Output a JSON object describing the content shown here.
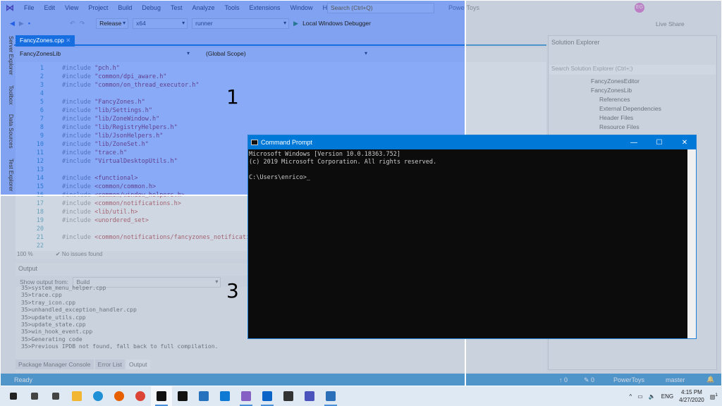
{
  "vs": {
    "menu": [
      "File",
      "Edit",
      "View",
      "Project",
      "Build",
      "Debug",
      "Test",
      "Analyze",
      "Tools",
      "Extensions",
      "Window",
      "Help"
    ],
    "search_placeholder": "Search (Ctrl+Q)",
    "solution_name": "PowerToys",
    "user_initials": "EG",
    "live_share": "Live Share",
    "config": "Release",
    "platform": "x64",
    "startup": "runner",
    "debugger": "Local Windows Debugger",
    "side_tools": [
      "Server Explorer",
      "Toolbox",
      "Data Sources",
      "Test Explorer"
    ],
    "tab": "FancyZones.cpp",
    "nav_project": "FancyZonesLib",
    "nav_scope": "(Global Scope)",
    "code": [
      [
        "1",
        "#include",
        "\"pch.h\""
      ],
      [
        "2",
        "#include",
        "\"common/dpi_aware.h\""
      ],
      [
        "3",
        "#include",
        "\"common/on_thread_executor.h\""
      ],
      [
        "4",
        "",
        ""
      ],
      [
        "5",
        "#include",
        "\"FancyZones.h\""
      ],
      [
        "6",
        "#include",
        "\"lib/Settings.h\""
      ],
      [
        "7",
        "#include",
        "\"lib/ZoneWindow.h\""
      ],
      [
        "8",
        "#include",
        "\"lib/RegistryHelpers.h\""
      ],
      [
        "9",
        "#include",
        "\"lib/JsonHelpers.h\""
      ],
      [
        "10",
        "#include",
        "\"lib/ZoneSet.h\""
      ],
      [
        "11",
        "#include",
        "\"trace.h\""
      ],
      [
        "12",
        "#include",
        "\"VirtualDesktopUtils.h\""
      ],
      [
        "13",
        "",
        ""
      ],
      [
        "14",
        "#include",
        "<functional>"
      ],
      [
        "15",
        "#include",
        "<common/common.h>"
      ],
      [
        "16",
        "#include",
        "<common/window_helpers.h>"
      ],
      [
        "17",
        "#include",
        "<common/notifications.h>"
      ],
      [
        "18",
        "#include",
        "<lib/util.h>"
      ],
      [
        "19",
        "#include",
        "<unordered_set>"
      ],
      [
        "20",
        "",
        ""
      ],
      [
        "21",
        "#include",
        "<common/notifications/fancyzones_notifications.h>"
      ],
      [
        "22",
        "",
        ""
      ]
    ],
    "zoom": "100 %",
    "issues": "No issues found",
    "output_title": "Output",
    "show_output_from": "Show output from:",
    "output_source": "Build",
    "output_lines": [
      "35>system_menu_helper.cpp",
      "35>trace.cpp",
      "35>tray_icon.cpp",
      "35>unhandled_exception_handler.cpp",
      "35>update_utils.cpp",
      "35>update_state.cpp",
      "35>win_hook_event.cpp",
      "35>Generating code",
      "35>Previous IPDB not found, fall back to full compilation."
    ],
    "output_tabs": [
      "Package Manager Console",
      "Error List",
      "Output"
    ],
    "status": "Ready",
    "status_up": "0",
    "status_edits": "0",
    "status_repo": "PowerToys",
    "status_branch": "master",
    "solex_title": "Solution Explorer",
    "solex_search": "Search Solution Explorer (Ctrl+;)",
    "tree": [
      "FancyZonesEditor",
      "FancyZonesLib",
      "References",
      "External Dependencies",
      "Header Files",
      "Resource Files"
    ]
  },
  "zones": {
    "z1": "1",
    "z3": "3",
    "z1_color": "#2864f0"
  },
  "cmd": {
    "title": "Command Prompt",
    "lines": [
      "Microsoft Windows [Version 10.0.18363.752]",
      "(c) 2019 Microsoft Corporation. All rights reserved.",
      "",
      "C:\\Users\\enrico>_"
    ],
    "title_color": "#0078d7"
  },
  "taskbar": {
    "icons": [
      "windows-start",
      "search",
      "task-view",
      "file-explorer",
      "edge",
      "firefox",
      "chrome",
      "command-prompt",
      "terminal",
      "powershell",
      "vscode",
      "visual-studio",
      "outlook",
      "onenote-clipper",
      "teams",
      "snipping-tool"
    ],
    "lang": "ENG",
    "time": "4:15 PM",
    "date": "4/27/2020",
    "notifications": "1"
  }
}
